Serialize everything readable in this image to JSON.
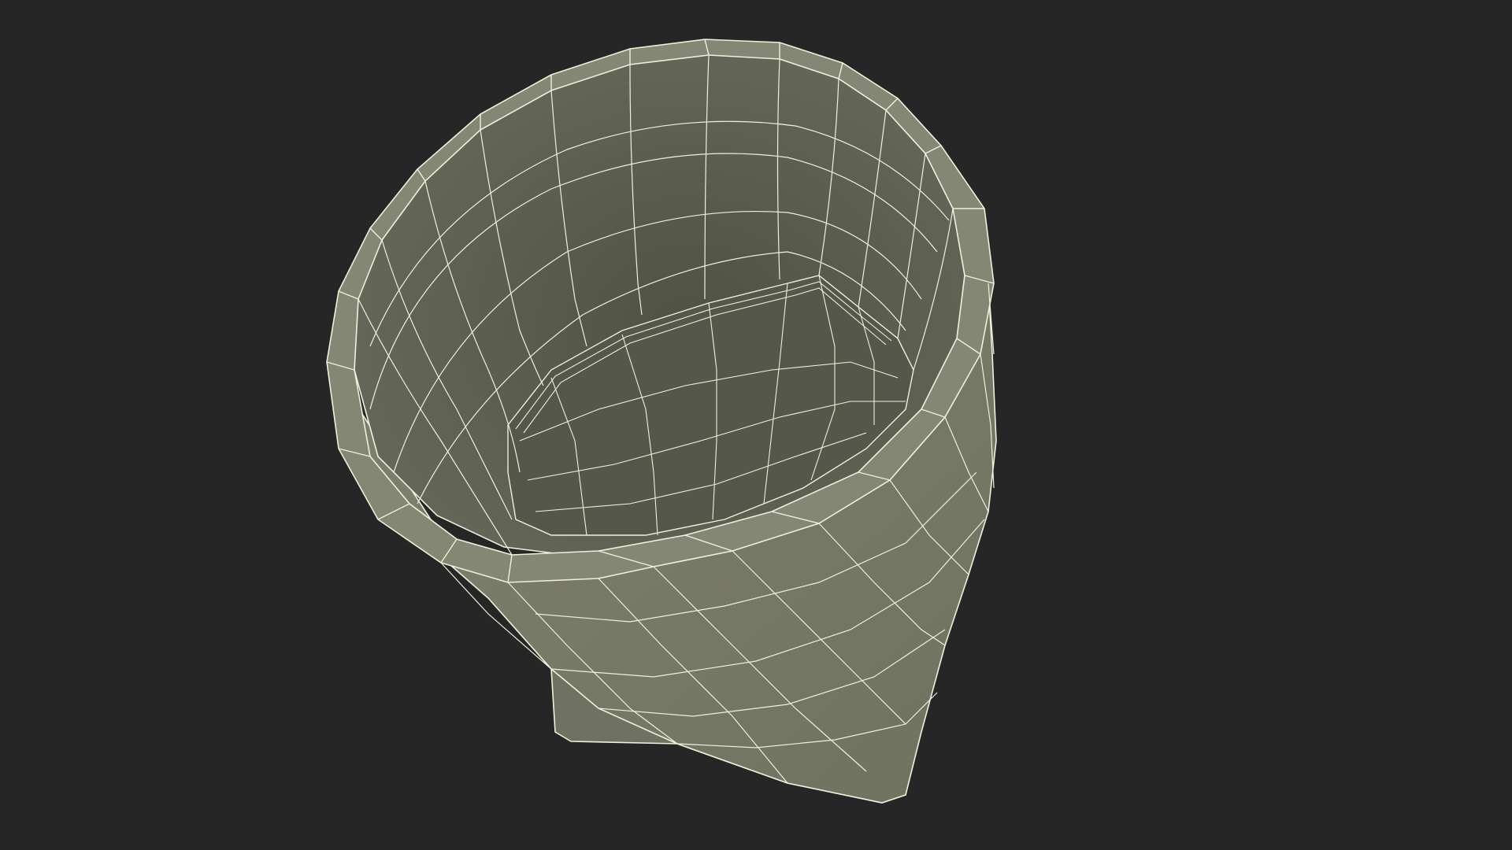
{
  "viewport": {
    "background_color": "#262626",
    "object": "wireframe-cup-model",
    "colors": {
      "inner_shade": "#5e6050",
      "inner_dark": "#4e5042",
      "outer_shade": "#7b7e6b",
      "rim_shade": "#888b77",
      "wire_color": "#f0f1dc"
    }
  }
}
